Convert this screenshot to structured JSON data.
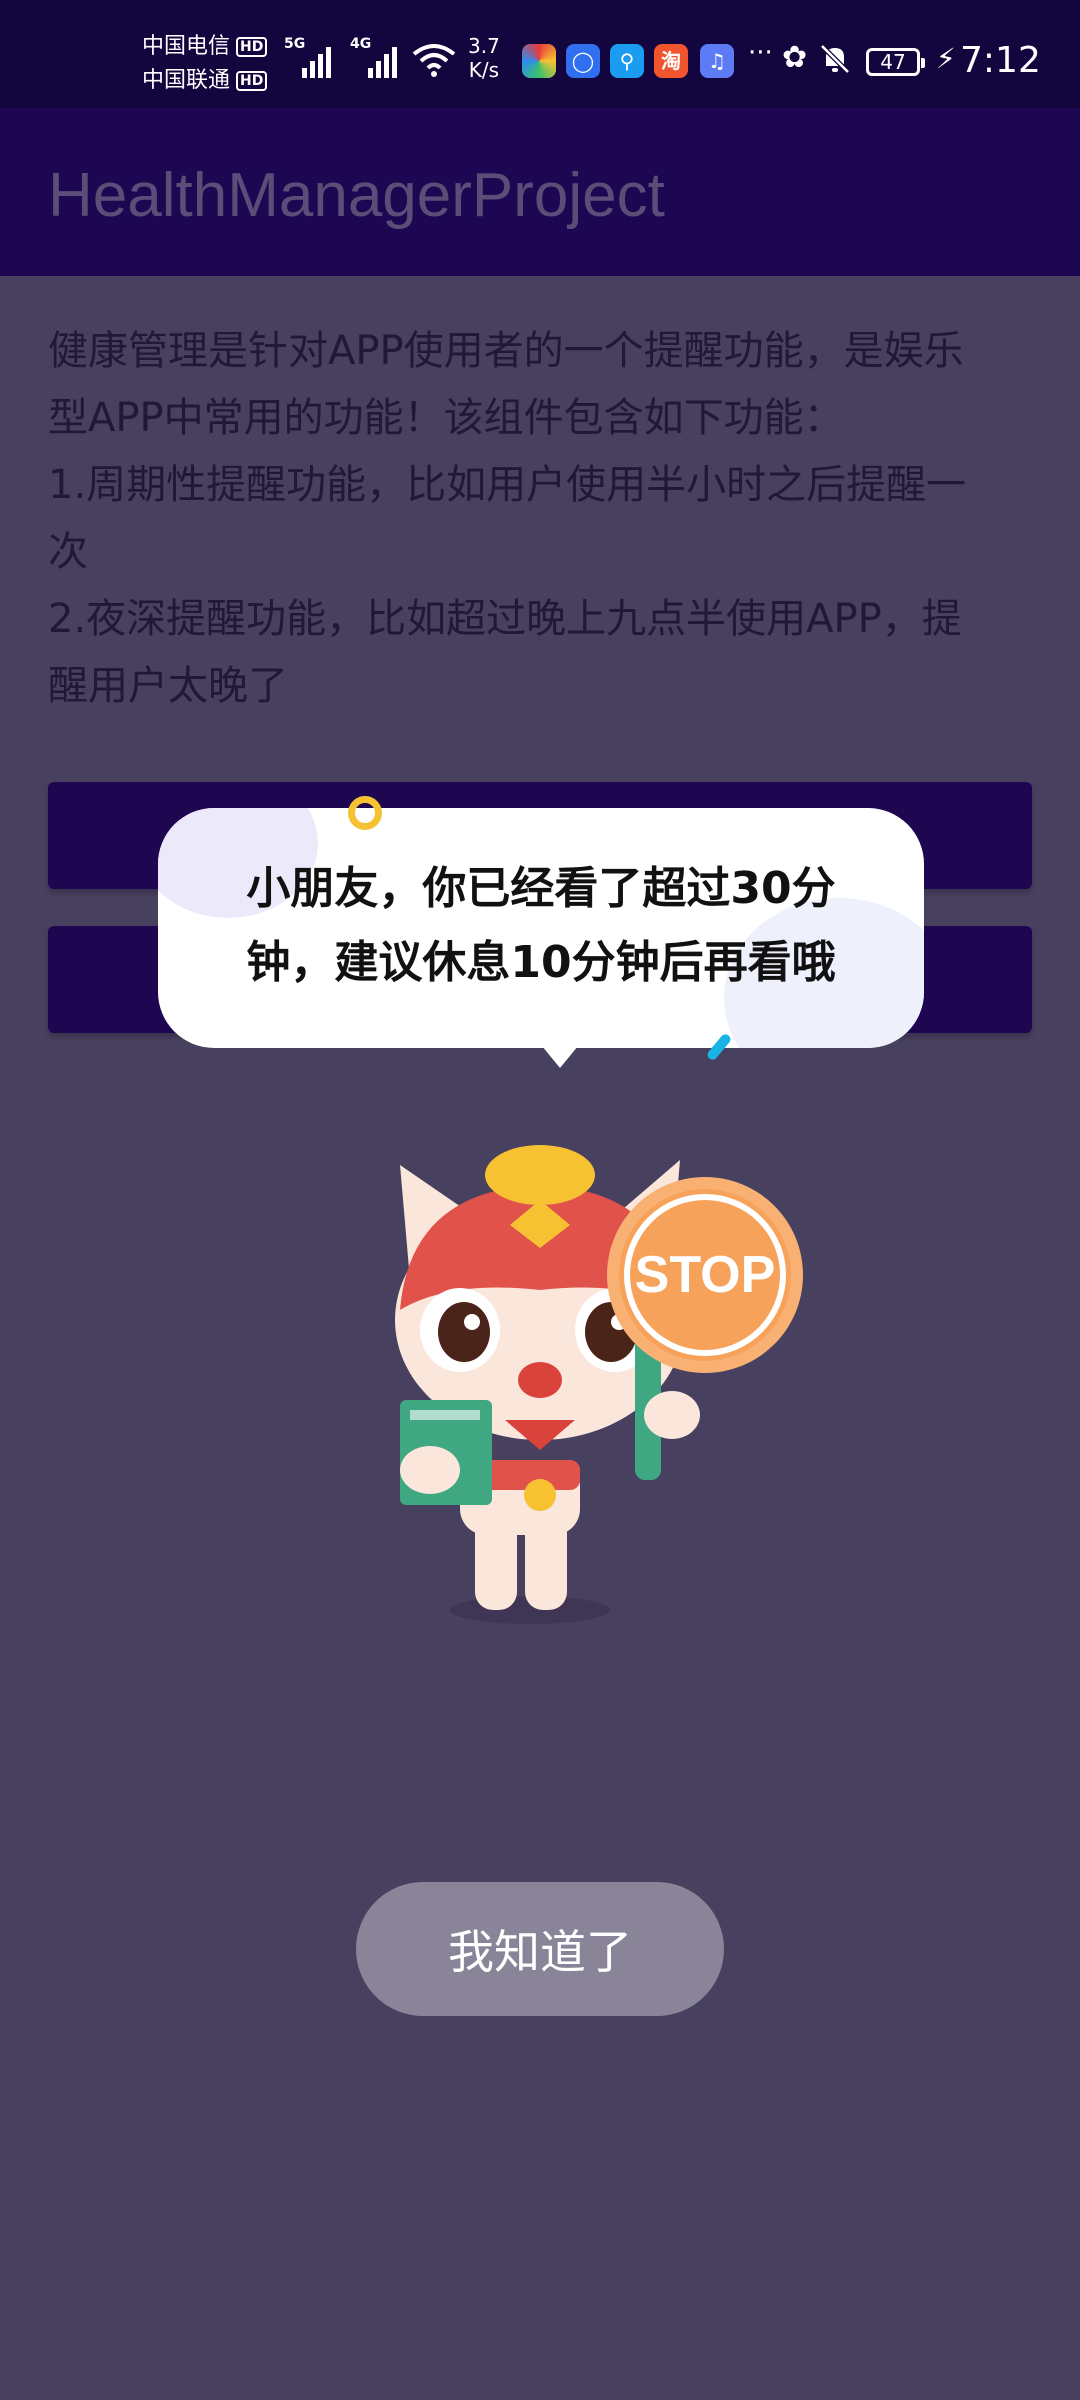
{
  "status_bar": {
    "carrier1": "中国电信",
    "carrier2": "中国联通",
    "hd_label": "HD",
    "net1": "5G",
    "net2": "4G",
    "speed_value": "3.7",
    "speed_unit": "K/s",
    "taobao_char": "淘",
    "more_dots": "···",
    "battery_level": "47",
    "time": "7:12"
  },
  "app_bar": {
    "title": "HealthManagerProject"
  },
  "description": "健康管理是针对APP使用者的一个提醒功能，是娱乐\n型APP中常用的功能！该组件包含如下功能：\n1.周期性提醒功能，比如用户使用半小时之后提醒一\n次\n2.夜深提醒功能，比如超过晚上九点半使用APP，提\n醒用户太晚了",
  "dialog": {
    "message": "小朋友，你已经看了超过30分\n钟，建议休息10分钟后再看哦",
    "sign_text": "STOP",
    "confirm_label": "我知道了"
  },
  "colors": {
    "scrim": "#47405f",
    "app_bar": "#1d0652",
    "status_bar": "#13063e",
    "button_bg": "#1f0650",
    "confirm_bg": "#8a8499",
    "stop_sign": "#f7a25a"
  }
}
